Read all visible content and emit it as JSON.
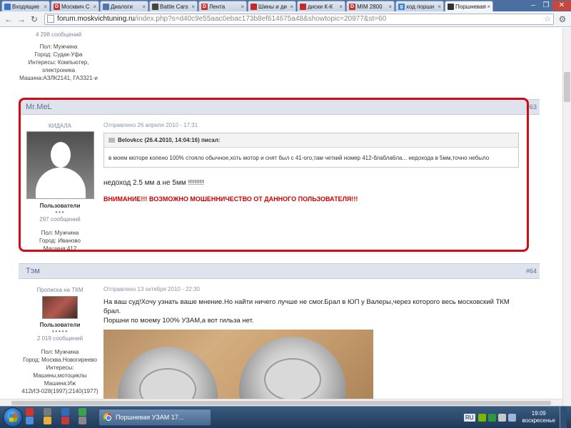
{
  "browser": {
    "tabs": [
      {
        "label": "Входящие",
        "favicon_color": "#3a74c9",
        "favicon_char": ""
      },
      {
        "label": "Москвич С",
        "favicon_color": "#c9332f",
        "favicon_char": "D"
      },
      {
        "label": "Диалоги",
        "favicon_color": "#4e76a8",
        "favicon_char": ""
      },
      {
        "label": "Battle Cars",
        "favicon_color": "#444444",
        "favicon_char": ""
      },
      {
        "label": "Лента",
        "favicon_color": "#c9332f",
        "favicon_char": "D"
      },
      {
        "label": "Шины и ди",
        "favicon_color": "#c42a2a",
        "favicon_char": ""
      },
      {
        "label": "диски К-К",
        "favicon_color": "#c42a2a",
        "favicon_char": ""
      },
      {
        "label": "MIM 2800",
        "favicon_color": "#c9332f",
        "favicon_char": "D"
      },
      {
        "label": "ход порши",
        "favicon_color": "#3d7ee0",
        "favicon_char": "g"
      },
      {
        "label": "Поршневая",
        "favicon_color": "#333333",
        "favicon_char": ""
      }
    ],
    "active_tab_index": 9,
    "close_glyph": "×",
    "url_host": "forum.moskvichtuning.ru",
    "url_rest": "/index.php?s=d40c9e55aac0ebac173b8ef614675a48&showtopic=20977&st=60"
  },
  "posts": [
    {
      "author": "",
      "number": "",
      "user_lines": [
        {
          "text": "4 298 сообщений",
          "style": "muted"
        },
        {
          "text": "Пол: Мужчина",
          "style": ""
        },
        {
          "text": "Город: Судак-Уфа",
          "style": ""
        },
        {
          "text": "Интересы: Компьютер, электроника",
          "style": ""
        },
        {
          "text": "Машина:АЗЛК2141, ГАЗ321-и",
          "style": ""
        }
      ]
    },
    {
      "author": "Mr.MeL",
      "number": "#63",
      "title": "КИДАЛА",
      "group": "Пользователи",
      "pips": "●●●",
      "posts_count": "297 сообщений",
      "gender": "Пол: Мужчина",
      "city": "Город: Иваново",
      "car": "Машина:412",
      "date": "Отправлено 26 апреля 2010 - 17:31",
      "quote_head": "Belovkcc (26.4.2010, 14:04:16) писал:",
      "quote_body": "в моем моторе копено 100% стояло обычное,хоть мотор и снят был с 41-ого,там четкий номер 412-блабла6ла... недохода в 5мм,точно небыло",
      "message": "недоход 2.5 мм а не 5мм !!!!!!!!",
      "warning": "ВНИМАНИЕ!!! ВОЗМОЖНО МОШЕННИЧЕСТВО ОТ ДАННОГО ПОЛЬЗОВАТЕЛЯ!!!",
      "warning_color": "#cc0000"
    },
    {
      "author": "Тэм",
      "number": "#64",
      "title": "Прописка на ТКМ",
      "group": "Пользователи",
      "pips": "●●●●●",
      "posts_count": "2 019 сообщений",
      "gender": "Пол: Мужчина",
      "city": "Город: Москва.Новогиреево",
      "interests": "Интересы: Машины,мотоциклы",
      "car": "Машина:Иж 412ИЭ-028(1997);2140(1977)",
      "date": "Отправлено 13 октября 2010 - 22:30",
      "message_line1": "На ваш суд!Хочу узнать ваше мнение.Но найти ничего лучше не смог.Брал в ЮП у Валеры,через которого весь московский ТКМ брал.",
      "message_line2": "Поршни по моему 100% УЗАМ,а вот гильза нет."
    }
  ],
  "taskbar": {
    "task_label": "Поршневая УЗАМ 17...",
    "lang": "RU",
    "time": "19:09",
    "day": "воскресенье"
  },
  "colors": {
    "header_bg": "#dfe3ee",
    "highlight": "#d10a14",
    "link": "#5a6f96"
  }
}
